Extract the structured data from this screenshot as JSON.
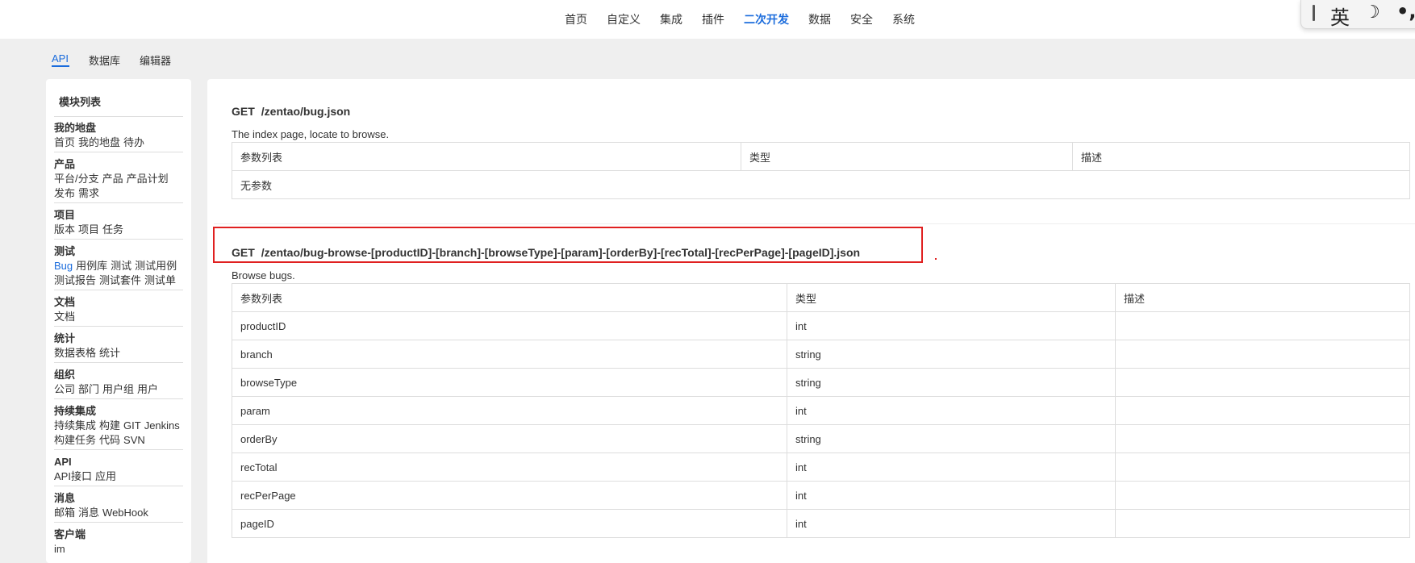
{
  "top_nav": {
    "items": [
      "首页",
      "自定义",
      "集成",
      "插件",
      "二次开发",
      "数据",
      "安全",
      "系统"
    ],
    "active": "二次开发"
  },
  "ime": {
    "lang": "英",
    "moon": "☽",
    "punct": "•,"
  },
  "sub_tabs": {
    "items": [
      "API",
      "数据库",
      "编辑器"
    ],
    "active": "API"
  },
  "sidebar": {
    "title": "模块列表",
    "modules": [
      {
        "name": "我的地盘",
        "links": [
          "首页",
          "我的地盘",
          "待办"
        ]
      },
      {
        "name": "产品",
        "links": [
          "平台/分支",
          "产品",
          "产品计划",
          "发布",
          "需求"
        ]
      },
      {
        "name": "项目",
        "links": [
          "版本",
          "项目",
          "任务"
        ]
      },
      {
        "name": "测试",
        "links": [
          "Bug",
          "用例库",
          "测试",
          "测试用例",
          "测试报告",
          "测试套件",
          "测试单"
        ],
        "active": "Bug"
      },
      {
        "name": "文档",
        "links": [
          "文档"
        ]
      },
      {
        "name": "统计",
        "links": [
          "数据表格",
          "统计"
        ]
      },
      {
        "name": "组织",
        "links": [
          "公司",
          "部门",
          "用户组",
          "用户"
        ]
      },
      {
        "name": "持续集成",
        "links": [
          "持续集成",
          "构建",
          "GIT",
          "Jenkins",
          "构建任务",
          "代码",
          "SVN"
        ]
      },
      {
        "name": "API",
        "links": [
          "API接口",
          "应用"
        ]
      },
      {
        "name": "消息",
        "links": [
          "邮箱",
          "消息",
          "WebHook"
        ]
      },
      {
        "name": "客户端",
        "links": [
          "im"
        ]
      }
    ]
  },
  "apis": [
    {
      "method": "GET",
      "path": "/zentao/bug.json",
      "description": "The index page, locate to browse.",
      "headers": [
        "参数列表",
        "类型",
        "描述"
      ],
      "empty_text": "无参数",
      "rows": []
    },
    {
      "method": "GET",
      "path": "/zentao/bug-browse-[productID]-[branch]-[browseType]-[param]-[orderBy]-[recTotal]-[recPerPage]-[pageID].json",
      "description": "Browse bugs.",
      "headers": [
        "参数列表",
        "类型",
        "描述"
      ],
      "rows": [
        [
          "productID",
          "int",
          ""
        ],
        [
          "branch",
          "string",
          ""
        ],
        [
          "browseType",
          "string",
          ""
        ],
        [
          "param",
          "int",
          ""
        ],
        [
          "orderBy",
          "string",
          ""
        ],
        [
          "recTotal",
          "int",
          ""
        ],
        [
          "recPerPage",
          "int",
          ""
        ],
        [
          "pageID",
          "int",
          ""
        ]
      ]
    }
  ],
  "colors": {
    "accent": "#1b6cdc",
    "highlight": "#e02020"
  }
}
